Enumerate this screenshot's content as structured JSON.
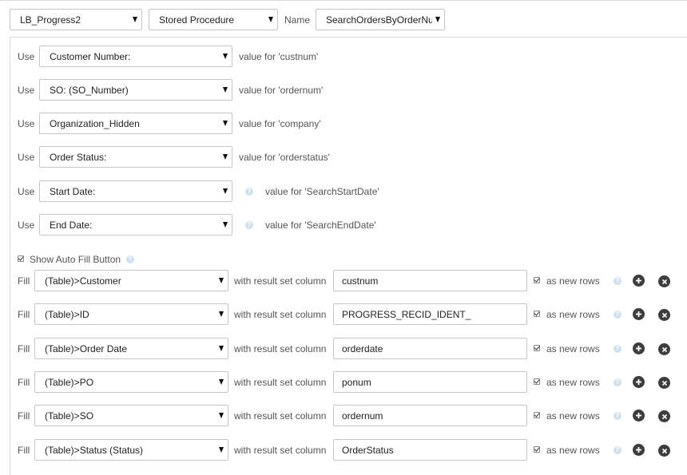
{
  "header": {
    "connection": "LB_Progress2",
    "type": "Stored Procedure",
    "name_label": "Name",
    "name_value": "SearchOrdersByOrderNum"
  },
  "params": [
    {
      "use_label": "Use",
      "field": "Customer Number:",
      "desc": "value for 'custnum'"
    },
    {
      "use_label": "Use",
      "field": "SO: (SO_Number)",
      "desc": "value for 'ordernum'"
    },
    {
      "use_label": "Use",
      "field": "Organization_Hidden",
      "desc": "value for 'company'"
    },
    {
      "use_label": "Use",
      "field": "Order Status:",
      "desc": "value for 'orderstatus'"
    },
    {
      "use_label": "Use",
      "field": "Start Date:",
      "desc": "value for 'SearchStartDate'"
    },
    {
      "use_label": "Use",
      "field": "End Date:",
      "desc": "value for 'SearchEndDate'"
    }
  ],
  "autofill": {
    "label": "Show Auto Fill Button",
    "checked": true
  },
  "fills": [
    {
      "fill_label": "Fill",
      "target": "(Table)>Customer",
      "with_label": "with result set column",
      "column": "custnum",
      "rows_label": "as new rows"
    },
    {
      "fill_label": "Fill",
      "target": "(Table)>ID",
      "with_label": "with result set column",
      "column": "PROGRESS_RECID_IDENT_",
      "rows_label": "as new rows"
    },
    {
      "fill_label": "Fill",
      "target": "(Table)>Order Date",
      "with_label": "with result set column",
      "column": "orderdate",
      "rows_label": "as new rows"
    },
    {
      "fill_label": "Fill",
      "target": "(Table)>PO",
      "with_label": "with result set column",
      "column": "ponum",
      "rows_label": "as new rows"
    },
    {
      "fill_label": "Fill",
      "target": "(Table)>SO",
      "with_label": "with result set column",
      "column": "ordernum",
      "rows_label": "as new rows"
    },
    {
      "fill_label": "Fill",
      "target": "(Table)>Status (Status)",
      "with_label": "with result set column",
      "column": "OrderStatus",
      "rows_label": "as new rows"
    }
  ],
  "icons": {
    "help": "help-icon",
    "add": "plus-circle-icon",
    "remove": "x-circle-icon",
    "caret": "caret-down-icon"
  },
  "colors": {
    "border": "#c6c6c6",
    "help": "#cfe1ee",
    "button": "#3d3d3d"
  }
}
